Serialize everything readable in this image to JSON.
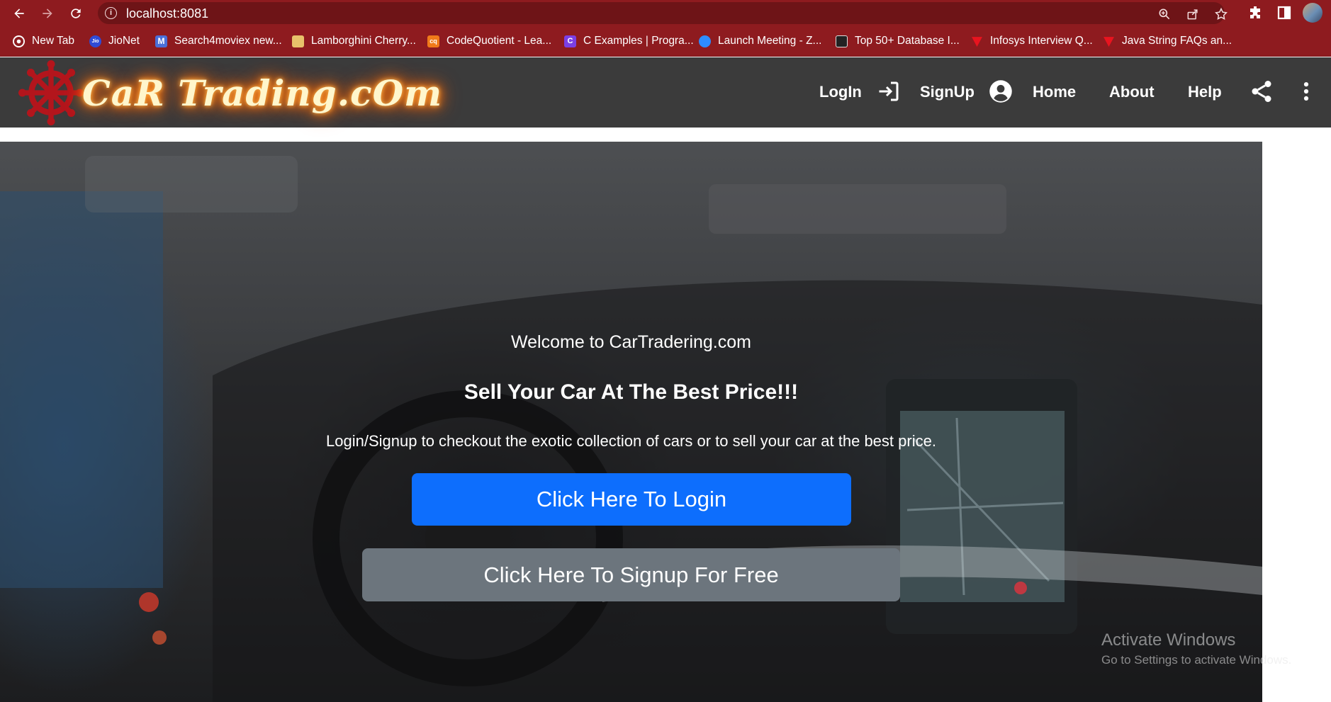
{
  "browser": {
    "url": "localhost:8081",
    "bookmarks": [
      {
        "label": "New Tab",
        "icon": "chrome-icon",
        "color": "#ffffff"
      },
      {
        "label": "JioNet",
        "icon": "jio-icon",
        "color": "#2f4bd6"
      },
      {
        "label": "Search4moviex new...",
        "icon": "m-icon",
        "color": "#4a6fd8"
      },
      {
        "label": "Lamborghini Cherry...",
        "icon": "image-icon",
        "color": "#e8c26a"
      },
      {
        "label": "CodeQuotient - Lea...",
        "icon": "cq-icon",
        "color": "#f07a1a"
      },
      {
        "label": "C Examples | Progra...",
        "icon": "c-icon",
        "color": "#7b3fe4"
      },
      {
        "label": "Launch Meeting - Z...",
        "icon": "zoom-icon",
        "color": "#2d8cff"
      },
      {
        "label": "Top 50+ Database I...",
        "icon": "db-icon",
        "color": "#222222"
      },
      {
        "label": "Infosys Interview Q...",
        "icon": "triangle-icon",
        "color": "#e8141f"
      },
      {
        "label": "Java String FAQs an...",
        "icon": "triangle-icon",
        "color": "#e8141f"
      }
    ]
  },
  "header": {
    "logo_text": "CaR Trading.cOm",
    "nav": {
      "login": "LogIn",
      "signup": "SignUp",
      "home": "Home",
      "about": "About",
      "help": "Help"
    }
  },
  "hero": {
    "welcome": "Welcome to CarTradering.com",
    "headline": "Sell Your Car At The Best Price!!!",
    "subtext": "Login/Signup to checkout the exotic collection of cars or to sell your car at the best price.",
    "login_button": "Click Here To Login",
    "signup_button": "Click Here To Signup For Free"
  },
  "watermark": {
    "title": "Activate Windows",
    "subtitle": "Go to Settings to activate Windows."
  },
  "colors": {
    "chrome": "#8e1b1f",
    "header_bg": "#3b3b3b",
    "primary_button": "#0d6efd",
    "secondary_button": "#6c757d",
    "logo_glow": "#ff6a00"
  }
}
